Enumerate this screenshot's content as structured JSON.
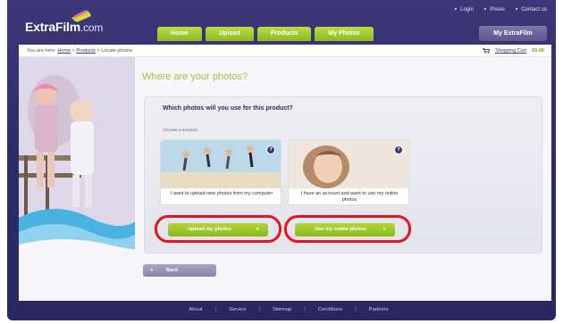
{
  "top_links": [
    "Login",
    "Prices",
    "Contact us"
  ],
  "logo": {
    "name": "ExtraFilm",
    "suffix": ".com"
  },
  "tabs": [
    "Home",
    "Upload",
    "Products",
    "My Photos"
  ],
  "account_button": "My ExtraFilm",
  "breadcrumb": {
    "prefix": "You are here:",
    "items": [
      "Home",
      "Products",
      "Locate photos"
    ]
  },
  "cart": {
    "label": "Shopping Cart",
    "amount": "€0.00"
  },
  "heading": "Where are your photos?",
  "panel": {
    "question": "Which photos will you use for this product?",
    "sub": "Choose a location:",
    "options": [
      {
        "text": "I want to upload new photos from my computer",
        "button": "Upload my photos",
        "badge": "?"
      },
      {
        "text": "I have an account and want to use my online photos",
        "button": "Use my online photos",
        "badge": "?"
      }
    ]
  },
  "back_button": "Back",
  "footer": [
    "About",
    "Service",
    "Sitemap",
    "Conditions",
    "Partners"
  ],
  "colors": {
    "brand_purple": "#3d3678",
    "accent_green": "#a1c23b",
    "highlight_red": "#e3141b"
  }
}
